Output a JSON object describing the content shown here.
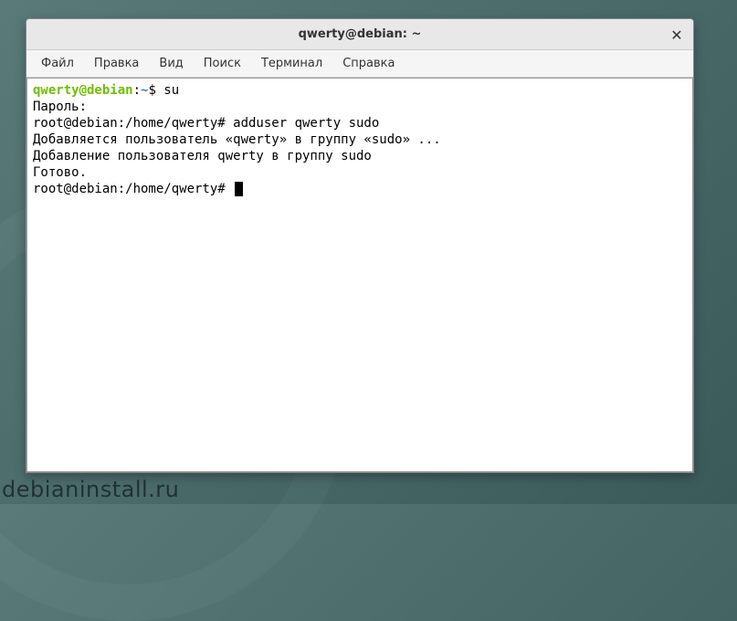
{
  "window": {
    "title": "qwerty@debian: ~"
  },
  "menu": {
    "file": "Файл",
    "edit": "Правка",
    "view": "Вид",
    "search": "Поиск",
    "terminal": "Терминал",
    "help": "Справка"
  },
  "terminal": {
    "line1_user": "qwerty@debian",
    "line1_colon": ":",
    "line1_path": "~",
    "line1_dollar_cmd": "$ su",
    "line2": "Пароль:",
    "line3": "root@debian:/home/qwerty# adduser qwerty sudo",
    "line4": "Добавляется пользователь «qwerty» в группу «sudo» ...",
    "line5": "Добавление пользователя qwerty в группу sudo",
    "line6": "Готово.",
    "line7_prompt": "root@debian:/home/qwerty# "
  },
  "watermark": "debianinstall.ru"
}
